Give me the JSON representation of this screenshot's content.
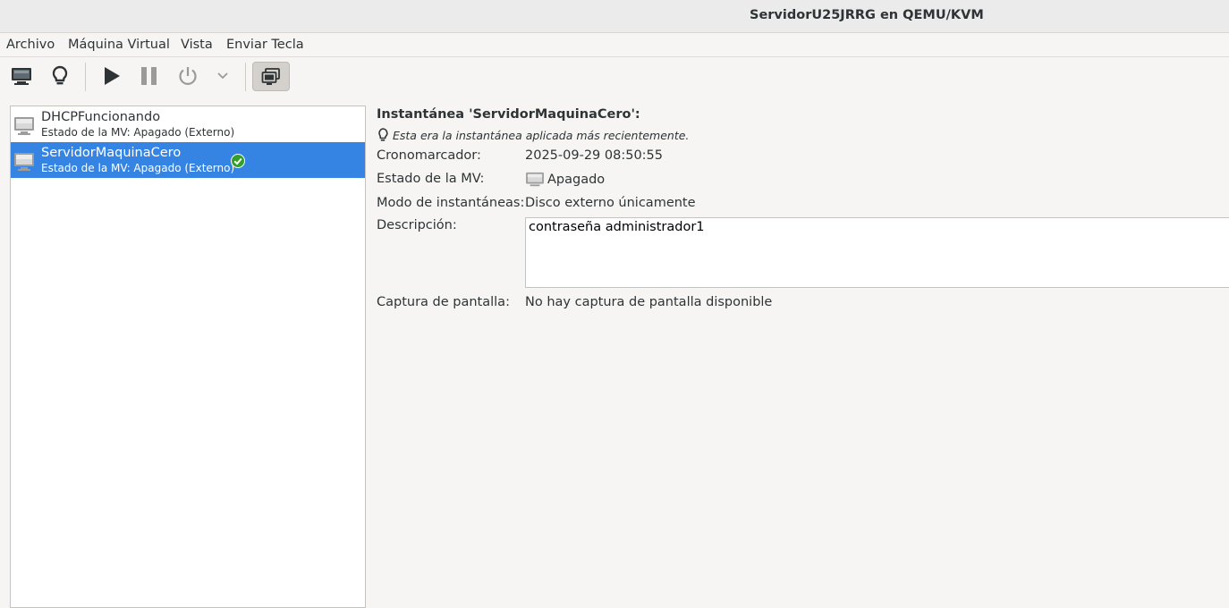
{
  "window": {
    "title": "ServidorU25JRRG en QEMU/KVM"
  },
  "menubar": {
    "items": [
      "Archivo",
      "Máquina Virtual",
      "Vista",
      "Enviar Tecla"
    ]
  },
  "toolbar": {
    "buttons": [
      "console-icon",
      "lightbulb-icon",
      "play-icon",
      "pause-icon",
      "power-icon",
      "chevron-down-icon",
      "snapshots-icon"
    ],
    "active": "snapshots-icon"
  },
  "snapshots": [
    {
      "name": "DHCPFuncionando",
      "state": "Estado de la MV: Apagado (Externo)",
      "selected": false,
      "current": false
    },
    {
      "name": "ServidorMaquinaCero",
      "state": "Estado de la MV: Apagado (Externo)",
      "selected": true,
      "current": true
    }
  ],
  "details": {
    "title": "Instantánea 'ServidorMaquinaCero':",
    "hint": "Esta era la instantánea aplicada más recientemente.",
    "timestamp_label": "Cronomarcador:",
    "timestamp_value": "2025-09-29 08:50:55",
    "state_label": "Estado de la MV:",
    "state_value": "Apagado",
    "mode_label": "Modo de instantáneas:",
    "mode_value": "Disco externo únicamente",
    "description_label": "Descripción:",
    "description_value": "contraseña administrador1",
    "screenshot_label": "Captura de pantalla:",
    "screenshot_value": "No hay captura de pantalla disponible"
  },
  "colors": {
    "selection": "#3584e4",
    "check": "#33a02c"
  }
}
